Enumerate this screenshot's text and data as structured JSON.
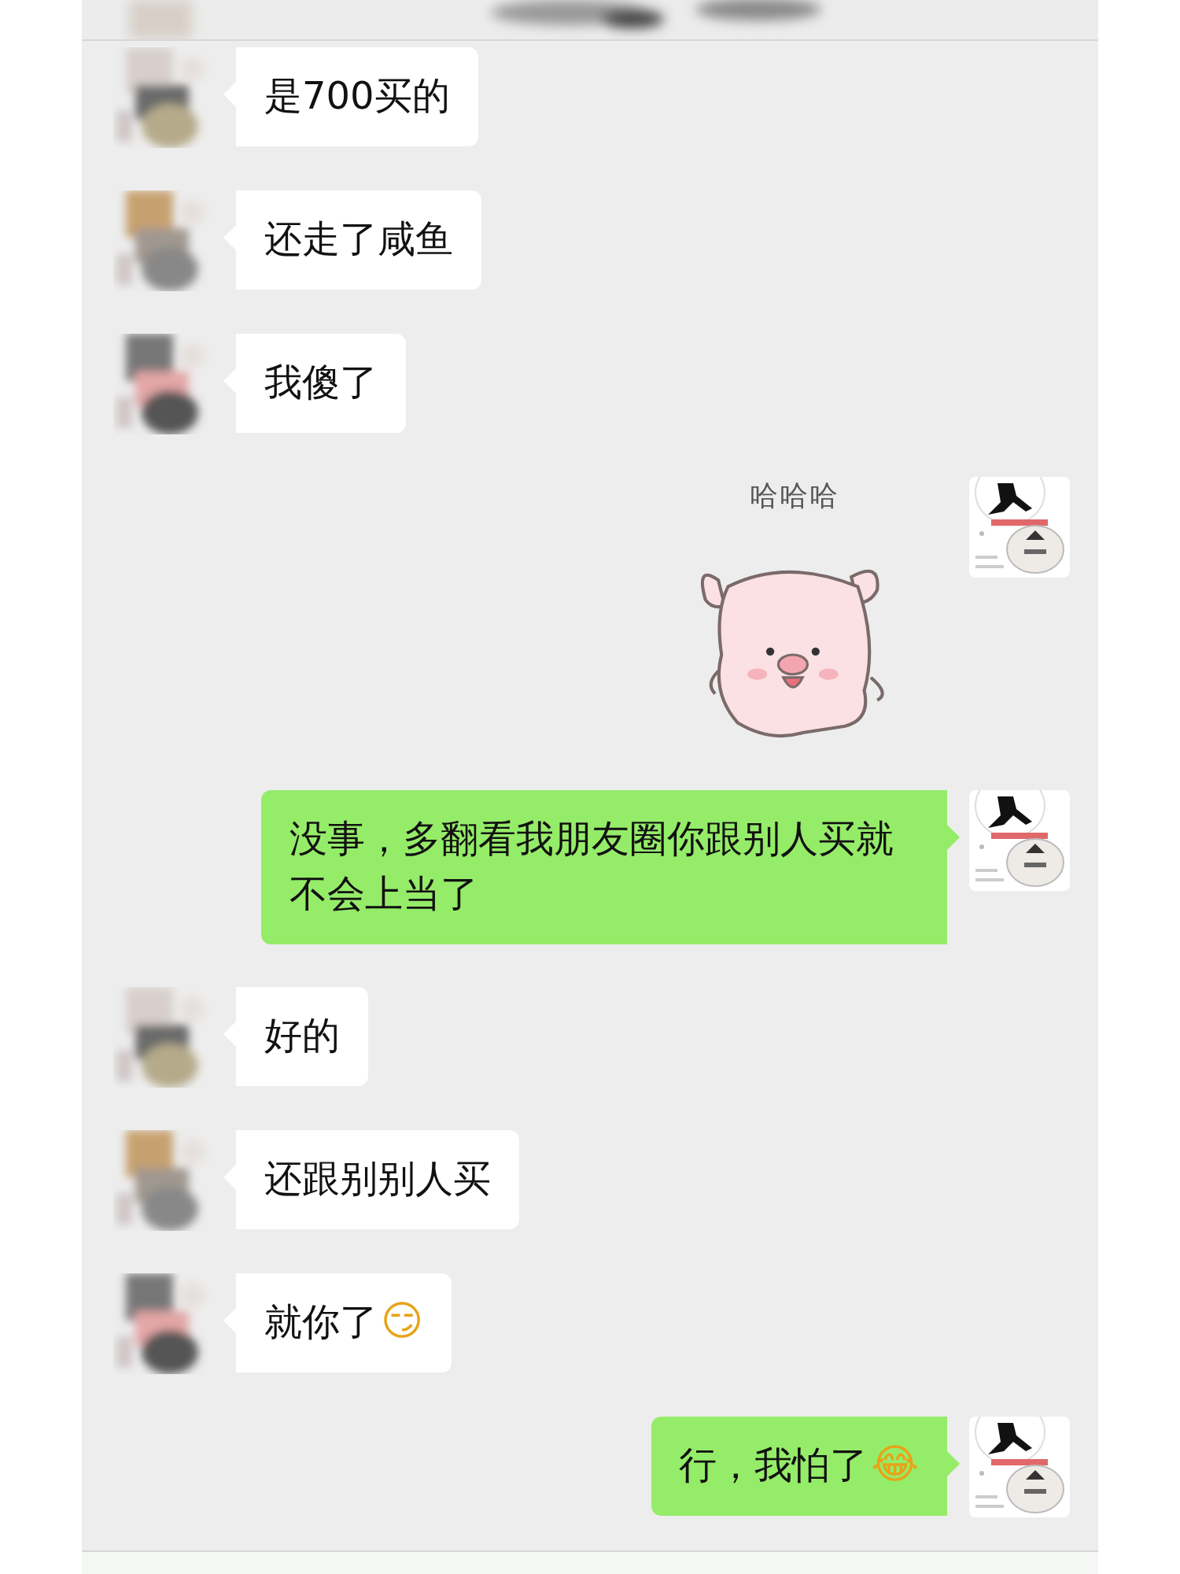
{
  "messages": [
    {
      "kind": "text",
      "outgoing": false,
      "text": "是700买的"
    },
    {
      "kind": "text",
      "outgoing": false,
      "text": "还走了咸鱼"
    },
    {
      "kind": "text",
      "outgoing": false,
      "text": "我傻了"
    },
    {
      "kind": "sticker",
      "outgoing": true,
      "caption": "哈哈哈"
    },
    {
      "kind": "text",
      "outgoing": true,
      "text": "没事，多翻看我朋友圈你跟别人买就不会上当了"
    },
    {
      "kind": "text",
      "outgoing": false,
      "text": "好的"
    },
    {
      "kind": "text",
      "outgoing": false,
      "text": "还跟别别人买"
    },
    {
      "kind": "text",
      "outgoing": false,
      "text": "就你了",
      "emoji": "😏"
    },
    {
      "kind": "text",
      "outgoing": true,
      "text": "行，我怕了",
      "emoji": "😂"
    }
  ]
}
